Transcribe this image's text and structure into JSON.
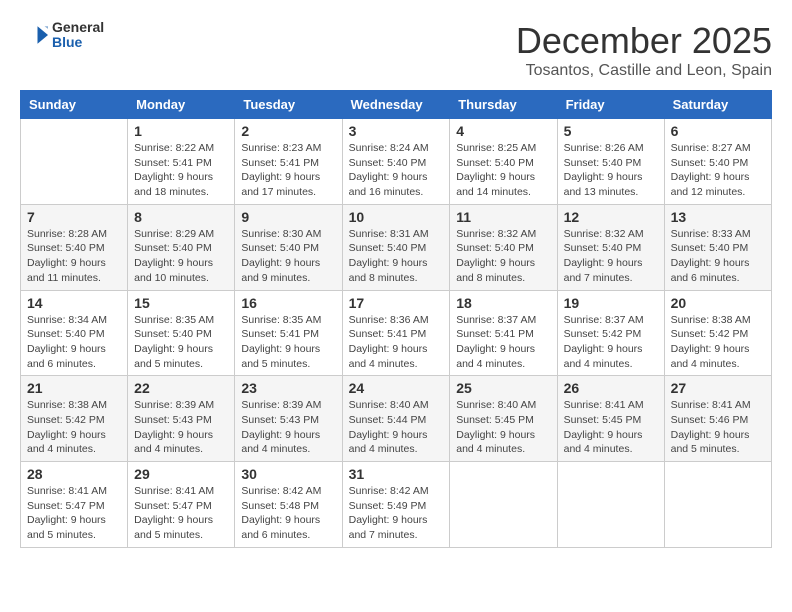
{
  "header": {
    "logo": {
      "general": "General",
      "blue": "Blue"
    },
    "month": "December 2025",
    "location": "Tosantos, Castille and Leon, Spain"
  },
  "days_of_week": [
    "Sunday",
    "Monday",
    "Tuesday",
    "Wednesday",
    "Thursday",
    "Friday",
    "Saturday"
  ],
  "weeks": [
    [
      {
        "day": "",
        "info": ""
      },
      {
        "day": "1",
        "info": "Sunrise: 8:22 AM\nSunset: 5:41 PM\nDaylight: 9 hours\nand 18 minutes."
      },
      {
        "day": "2",
        "info": "Sunrise: 8:23 AM\nSunset: 5:41 PM\nDaylight: 9 hours\nand 17 minutes."
      },
      {
        "day": "3",
        "info": "Sunrise: 8:24 AM\nSunset: 5:40 PM\nDaylight: 9 hours\nand 16 minutes."
      },
      {
        "day": "4",
        "info": "Sunrise: 8:25 AM\nSunset: 5:40 PM\nDaylight: 9 hours\nand 14 minutes."
      },
      {
        "day": "5",
        "info": "Sunrise: 8:26 AM\nSunset: 5:40 PM\nDaylight: 9 hours\nand 13 minutes."
      },
      {
        "day": "6",
        "info": "Sunrise: 8:27 AM\nSunset: 5:40 PM\nDaylight: 9 hours\nand 12 minutes."
      }
    ],
    [
      {
        "day": "7",
        "info": "Sunrise: 8:28 AM\nSunset: 5:40 PM\nDaylight: 9 hours\nand 11 minutes."
      },
      {
        "day": "8",
        "info": "Sunrise: 8:29 AM\nSunset: 5:40 PM\nDaylight: 9 hours\nand 10 minutes."
      },
      {
        "day": "9",
        "info": "Sunrise: 8:30 AM\nSunset: 5:40 PM\nDaylight: 9 hours\nand 9 minutes."
      },
      {
        "day": "10",
        "info": "Sunrise: 8:31 AM\nSunset: 5:40 PM\nDaylight: 9 hours\nand 8 minutes."
      },
      {
        "day": "11",
        "info": "Sunrise: 8:32 AM\nSunset: 5:40 PM\nDaylight: 9 hours\nand 8 minutes."
      },
      {
        "day": "12",
        "info": "Sunrise: 8:32 AM\nSunset: 5:40 PM\nDaylight: 9 hours\nand 7 minutes."
      },
      {
        "day": "13",
        "info": "Sunrise: 8:33 AM\nSunset: 5:40 PM\nDaylight: 9 hours\nand 6 minutes."
      }
    ],
    [
      {
        "day": "14",
        "info": "Sunrise: 8:34 AM\nSunset: 5:40 PM\nDaylight: 9 hours\nand 6 minutes."
      },
      {
        "day": "15",
        "info": "Sunrise: 8:35 AM\nSunset: 5:40 PM\nDaylight: 9 hours\nand 5 minutes."
      },
      {
        "day": "16",
        "info": "Sunrise: 8:35 AM\nSunset: 5:41 PM\nDaylight: 9 hours\nand 5 minutes."
      },
      {
        "day": "17",
        "info": "Sunrise: 8:36 AM\nSunset: 5:41 PM\nDaylight: 9 hours\nand 4 minutes."
      },
      {
        "day": "18",
        "info": "Sunrise: 8:37 AM\nSunset: 5:41 PM\nDaylight: 9 hours\nand 4 minutes."
      },
      {
        "day": "19",
        "info": "Sunrise: 8:37 AM\nSunset: 5:42 PM\nDaylight: 9 hours\nand 4 minutes."
      },
      {
        "day": "20",
        "info": "Sunrise: 8:38 AM\nSunset: 5:42 PM\nDaylight: 9 hours\nand 4 minutes."
      }
    ],
    [
      {
        "day": "21",
        "info": "Sunrise: 8:38 AM\nSunset: 5:42 PM\nDaylight: 9 hours\nand 4 minutes."
      },
      {
        "day": "22",
        "info": "Sunrise: 8:39 AM\nSunset: 5:43 PM\nDaylight: 9 hours\nand 4 minutes."
      },
      {
        "day": "23",
        "info": "Sunrise: 8:39 AM\nSunset: 5:43 PM\nDaylight: 9 hours\nand 4 minutes."
      },
      {
        "day": "24",
        "info": "Sunrise: 8:40 AM\nSunset: 5:44 PM\nDaylight: 9 hours\nand 4 minutes."
      },
      {
        "day": "25",
        "info": "Sunrise: 8:40 AM\nSunset: 5:45 PM\nDaylight: 9 hours\nand 4 minutes."
      },
      {
        "day": "26",
        "info": "Sunrise: 8:41 AM\nSunset: 5:45 PM\nDaylight: 9 hours\nand 4 minutes."
      },
      {
        "day": "27",
        "info": "Sunrise: 8:41 AM\nSunset: 5:46 PM\nDaylight: 9 hours\nand 5 minutes."
      }
    ],
    [
      {
        "day": "28",
        "info": "Sunrise: 8:41 AM\nSunset: 5:47 PM\nDaylight: 9 hours\nand 5 minutes."
      },
      {
        "day": "29",
        "info": "Sunrise: 8:41 AM\nSunset: 5:47 PM\nDaylight: 9 hours\nand 5 minutes."
      },
      {
        "day": "30",
        "info": "Sunrise: 8:42 AM\nSunset: 5:48 PM\nDaylight: 9 hours\nand 6 minutes."
      },
      {
        "day": "31",
        "info": "Sunrise: 8:42 AM\nSunset: 5:49 PM\nDaylight: 9 hours\nand 7 minutes."
      },
      {
        "day": "",
        "info": ""
      },
      {
        "day": "",
        "info": ""
      },
      {
        "day": "",
        "info": ""
      }
    ]
  ]
}
